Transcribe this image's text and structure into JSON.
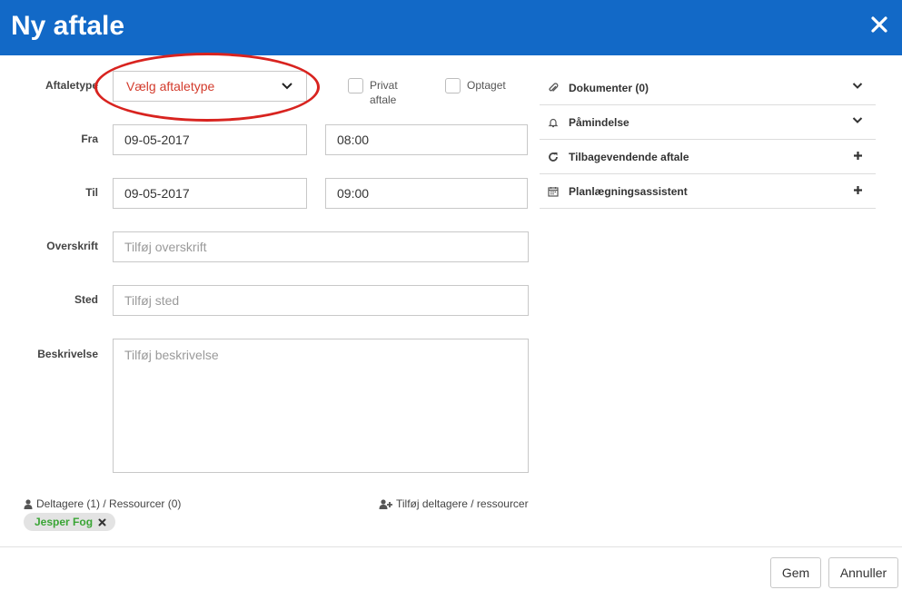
{
  "header": {
    "title": "Ny aftale",
    "close_icon": "close-icon"
  },
  "form": {
    "aftaletype": {
      "label": "Aftaletype",
      "value": "Vælg aftaletype"
    },
    "privat": {
      "label_line1": "Privat",
      "label_line2": "aftale",
      "checked": false
    },
    "optaget": {
      "label": "Optaget",
      "checked": false
    },
    "fra": {
      "label": "Fra",
      "date": "09-05-2017",
      "time": "08:00"
    },
    "til": {
      "label": "Til",
      "date": "09-05-2017",
      "time": "09:00"
    },
    "overskrift": {
      "label": "Overskrift",
      "placeholder": "Tilføj overskrift"
    },
    "sted": {
      "label": "Sted",
      "placeholder": "Tilføj sted"
    },
    "beskrivelse": {
      "label": "Beskrivelse",
      "placeholder": "Tilføj beskrivelse"
    }
  },
  "participants": {
    "label": "Deltagere (1) / Ressourcer (0)",
    "add_label": "Tilføj deltagere / ressourcer",
    "chips": [
      {
        "name": "Jesper Fog"
      }
    ]
  },
  "sidebar": {
    "items": [
      {
        "label": "Dokumenter (0)",
        "icon": "paperclip-icon",
        "action": "chevron-down-icon"
      },
      {
        "label": "Påmindelse",
        "icon": "bell-icon",
        "action": "chevron-down-icon"
      },
      {
        "label": "Tilbagevendende aftale",
        "icon": "refresh-icon",
        "action": "plus-icon"
      },
      {
        "label": "Planlægningsassistent",
        "icon": "calendar-icon",
        "action": "plus-icon"
      }
    ]
  },
  "footer": {
    "save_label": "Gem",
    "cancel_label": "Annuller"
  },
  "colors": {
    "header_bg": "#1269c7",
    "accent_red": "#d33b2c",
    "chip_text": "#3aa535"
  }
}
